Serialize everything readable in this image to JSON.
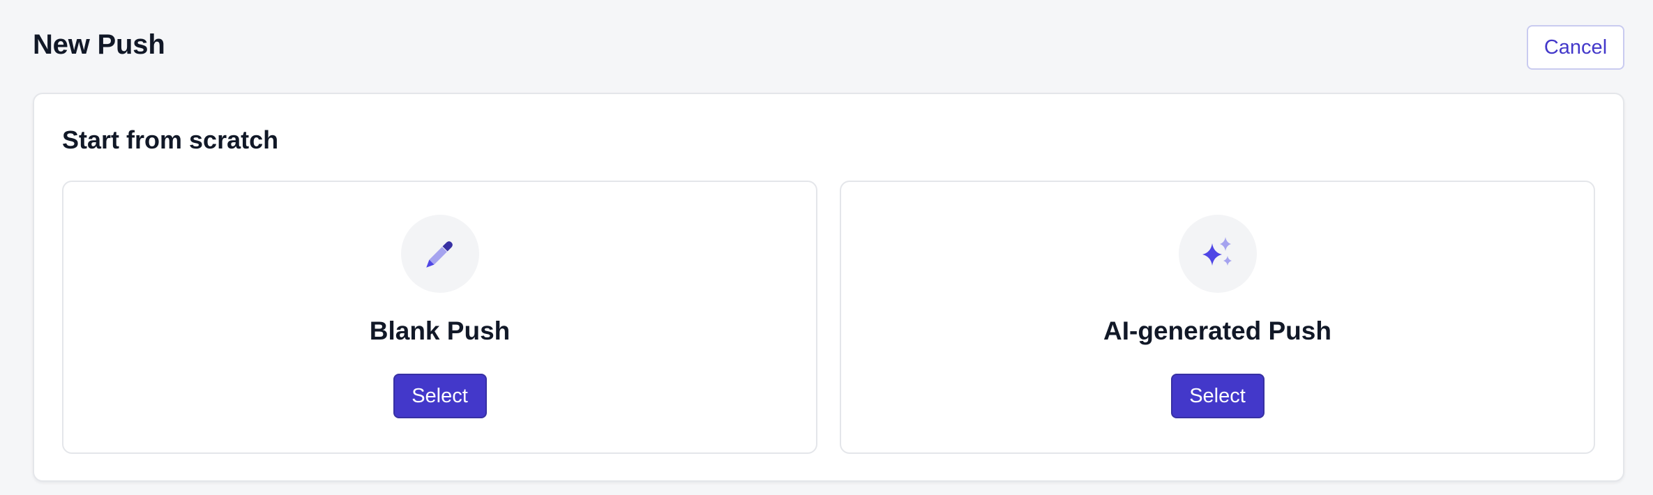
{
  "header": {
    "title": "New Push",
    "cancel_label": "Cancel"
  },
  "section": {
    "title": "Start from scratch"
  },
  "options": [
    {
      "title": "Blank Push",
      "select_label": "Select",
      "icon": "pencil-icon"
    },
    {
      "title": "AI-generated Push",
      "select_label": "Select",
      "icon": "sparkles-icon"
    }
  ],
  "colors": {
    "accent": "#4338ca",
    "icon_primary": "#4f46e5",
    "icon_light": "#a5a3ef",
    "page_background": "#f5f6f8"
  }
}
